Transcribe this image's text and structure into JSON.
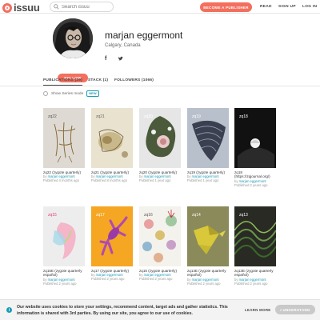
{
  "header": {
    "logo_text": "issuu",
    "search_placeholder": "Search issuu",
    "publisher_button": "BECOME A PUBLISHER",
    "nav": [
      "READ",
      "SIGN UP",
      "LOG IN"
    ]
  },
  "profile": {
    "name": "marjan eggermont",
    "location": "Calgary, Canada",
    "social": [
      "facebook-icon",
      "twitter-icon"
    ],
    "follow_button": "FOLLOW"
  },
  "tabs": [
    "PUBLICATIONS (29)",
    "STACK (1)",
    "FOLLOWERS (1066)"
  ],
  "series_toggle": {
    "label": "Show Series mode",
    "badge": "NEW"
  },
  "publications": [
    {
      "cover_label": "zq22",
      "title": "zq22 (zygote quarterly)",
      "author": "marjan eggermont",
      "date": "Published 4 months ago"
    },
    {
      "cover_label": "zq21",
      "title": "zq21 (zygote quarterly)",
      "author": "marjan eggermont",
      "date": "Published 8 months ago"
    },
    {
      "cover_label": "zq20",
      "title": "zq20 (zygote quarterly)",
      "author": "marjan eggermont",
      "date": "Published 1 year ago"
    },
    {
      "cover_label": "zq19",
      "title": "zq19 (zygote quarterly)",
      "author": "marjan eggermont",
      "date": "Published 1 year ago"
    },
    {
      "cover_label": "zq18",
      "title": "zq18 (https://zqjournal.org/)",
      "author": "marjan eggermont",
      "date": "Published 2 years ago"
    },
    {
      "cover_label": "zq15",
      "title": "zq15E (zygote quarterly español)",
      "author": "marjan eggermont",
      "date": "Published 2 years ago"
    },
    {
      "cover_label": "zq17",
      "title": "zq17 (zygote quarterly)",
      "author": "marjan eggermont",
      "date": "Published 2 years ago"
    },
    {
      "cover_label": "zq16",
      "title": "zq16 (zygote quarterly)",
      "author": "marjan eggermont",
      "date": "Published 2 years ago"
    },
    {
      "cover_label": "zq14",
      "title": "zq14E (zygote quarterly español)",
      "author": "marjan eggermont",
      "date": "Published 2 years ago"
    },
    {
      "cover_label": "zq13",
      "title": "zq13E (zygote quarterly español)",
      "author": "marjan eggermont",
      "date": "Published 2 years ago"
    }
  ],
  "cookie": {
    "text": "Our website uses cookies to store your settings, recommend content, target ads and gather statistics. This information is shared with 3rd parties. By using our site, you agree to our use of cookies.",
    "learn_more": "LEARN MORE",
    "accept": "I UNDERSTAND"
  },
  "colors": {
    "accent": "#f36f5e",
    "link": "#1a9bb5"
  }
}
